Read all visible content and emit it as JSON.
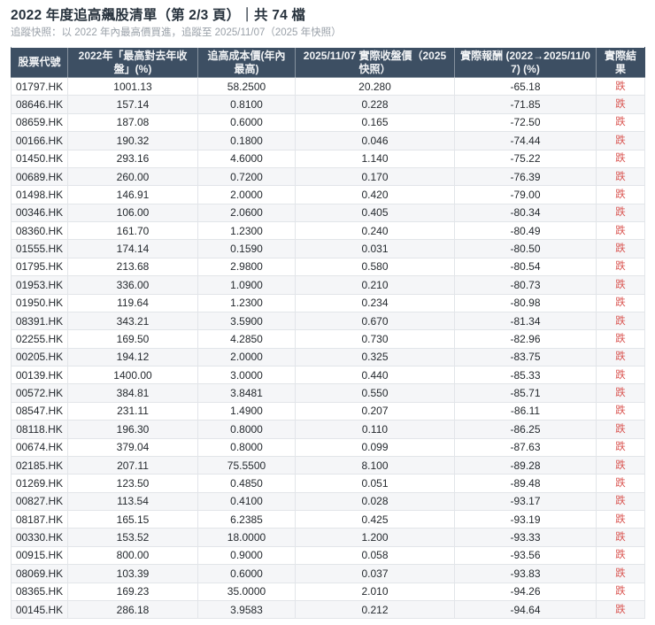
{
  "header": {
    "title": "2022 年度追高飆股清單（第 2/3 頁）｜共 74 檔",
    "subtitle": "追蹤快照：以 2022 年內最高價買進，追蹤至 2025/11/07（2025 年快照）"
  },
  "colors": {
    "header_bg": "#3d4f63",
    "down_red": "#d9534f",
    "row_alt_bg": "#f5f6f8"
  },
  "table": {
    "columns": [
      "股票代號",
      "2022年「最高對去年收盤」(%)",
      "追高成本價(年內最高)",
      "2025/11/07 實際收盤價（2025 快照）",
      "實際報酬 (2022→2025/11/07) (%)",
      "實際結果"
    ],
    "rows": [
      [
        "01797.HK",
        "1001.13",
        "58.2500",
        "20.280",
        "-65.18",
        "跌"
      ],
      [
        "08646.HK",
        "157.14",
        "0.8100",
        "0.228",
        "-71.85",
        "跌"
      ],
      [
        "08659.HK",
        "187.08",
        "0.6000",
        "0.165",
        "-72.50",
        "跌"
      ],
      [
        "00166.HK",
        "190.32",
        "0.1800",
        "0.046",
        "-74.44",
        "跌"
      ],
      [
        "01450.HK",
        "293.16",
        "4.6000",
        "1.140",
        "-75.22",
        "跌"
      ],
      [
        "00689.HK",
        "260.00",
        "0.7200",
        "0.170",
        "-76.39",
        "跌"
      ],
      [
        "01498.HK",
        "146.91",
        "2.0000",
        "0.420",
        "-79.00",
        "跌"
      ],
      [
        "00346.HK",
        "106.00",
        "2.0600",
        "0.405",
        "-80.34",
        "跌"
      ],
      [
        "08360.HK",
        "161.70",
        "1.2300",
        "0.240",
        "-80.49",
        "跌"
      ],
      [
        "01555.HK",
        "174.14",
        "0.1590",
        "0.031",
        "-80.50",
        "跌"
      ],
      [
        "01795.HK",
        "213.68",
        "2.9800",
        "0.580",
        "-80.54",
        "跌"
      ],
      [
        "01953.HK",
        "336.00",
        "1.0900",
        "0.210",
        "-80.73",
        "跌"
      ],
      [
        "01950.HK",
        "119.64",
        "1.2300",
        "0.234",
        "-80.98",
        "跌"
      ],
      [
        "08391.HK",
        "343.21",
        "3.5900",
        "0.670",
        "-81.34",
        "跌"
      ],
      [
        "02255.HK",
        "169.50",
        "4.2850",
        "0.730",
        "-82.96",
        "跌"
      ],
      [
        "00205.HK",
        "194.12",
        "2.0000",
        "0.325",
        "-83.75",
        "跌"
      ],
      [
        "00139.HK",
        "1400.00",
        "3.0000",
        "0.440",
        "-85.33",
        "跌"
      ],
      [
        "00572.HK",
        "384.81",
        "3.8481",
        "0.550",
        "-85.71",
        "跌"
      ],
      [
        "08547.HK",
        "231.11",
        "1.4900",
        "0.207",
        "-86.11",
        "跌"
      ],
      [
        "08118.HK",
        "196.30",
        "0.8000",
        "0.110",
        "-86.25",
        "跌"
      ],
      [
        "00674.HK",
        "379.04",
        "0.8000",
        "0.099",
        "-87.63",
        "跌"
      ],
      [
        "02185.HK",
        "207.11",
        "75.5500",
        "8.100",
        "-89.28",
        "跌"
      ],
      [
        "01269.HK",
        "123.50",
        "0.4850",
        "0.051",
        "-89.48",
        "跌"
      ],
      [
        "00827.HK",
        "113.54",
        "0.4100",
        "0.028",
        "-93.17",
        "跌"
      ],
      [
        "08187.HK",
        "165.15",
        "6.2385",
        "0.425",
        "-93.19",
        "跌"
      ],
      [
        "00330.HK",
        "153.52",
        "18.0000",
        "1.200",
        "-93.33",
        "跌"
      ],
      [
        "00915.HK",
        "800.00",
        "0.9000",
        "0.058",
        "-93.56",
        "跌"
      ],
      [
        "08069.HK",
        "103.39",
        "0.6000",
        "0.037",
        "-93.83",
        "跌"
      ],
      [
        "08365.HK",
        "169.23",
        "35.0000",
        "2.010",
        "-94.26",
        "跌"
      ],
      [
        "00145.HK",
        "286.18",
        "3.9583",
        "0.212",
        "-94.64",
        "跌"
      ]
    ]
  }
}
